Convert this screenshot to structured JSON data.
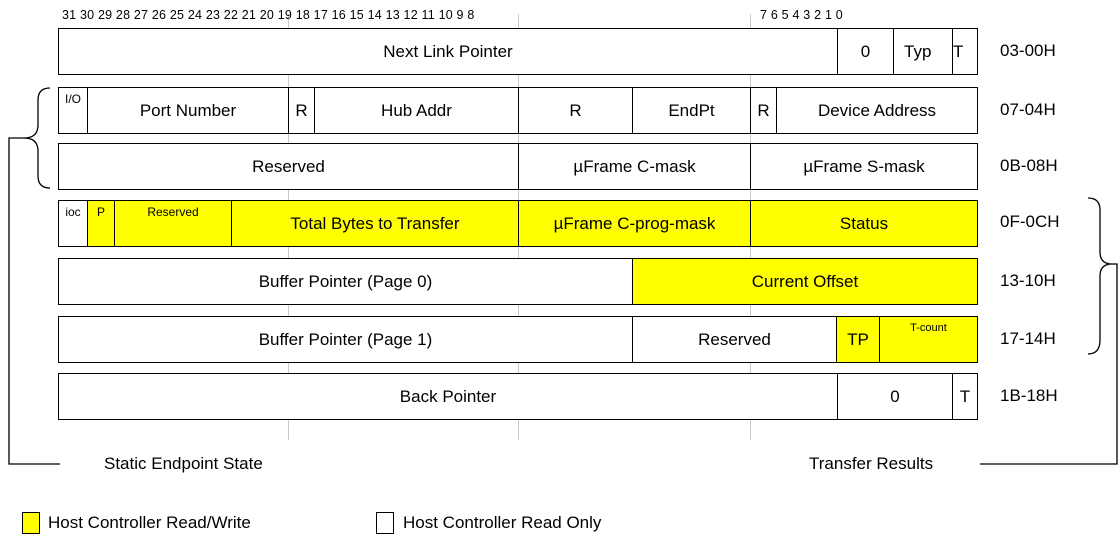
{
  "bit_ruler": {
    "high": "31 30 29 28 27 26 25 24 23 22 21 20 19 18 17 16 15 14 13 12 11 10 9 8",
    "low": "7 6 5 4 3 2 1 0"
  },
  "rows": [
    {
      "address": "03-00H",
      "fields": [
        "Next Link Pointer",
        "0",
        "Typ",
        "T"
      ]
    },
    {
      "address": "07-04H",
      "fields": [
        "I/O",
        "Port Number",
        "R",
        "Hub Addr",
        "R",
        "EndPt",
        "R",
        "Device Address"
      ]
    },
    {
      "address": "0B-08H",
      "fields": [
        "Reserved",
        "µFrame C-mask",
        "µFrame S-mask"
      ]
    },
    {
      "address": "0F-0CH",
      "fields": [
        "ioc",
        "P",
        "Reserved",
        "Total Bytes to Transfer",
        "µFrame C-prog-mask",
        "Status"
      ]
    },
    {
      "address": "13-10H",
      "fields": [
        "Buffer Pointer (Page 0)",
        "Current Offset"
      ]
    },
    {
      "address": "17-14H",
      "fields": [
        "Buffer Pointer (Page 1)",
        "Reserved",
        "TP",
        "T-count"
      ]
    },
    {
      "address": "1B-18H",
      "fields": [
        "Back Pointer",
        "0",
        "T"
      ]
    }
  ],
  "captions": {
    "static": "Static Endpoint State",
    "results": "Transfer Results"
  },
  "legend": {
    "read_write": "Host Controller Read/Write",
    "read_only": "Host Controller Read Only"
  },
  "colors": {
    "read_write": "#ffff00",
    "read_only": "#ffffff"
  }
}
